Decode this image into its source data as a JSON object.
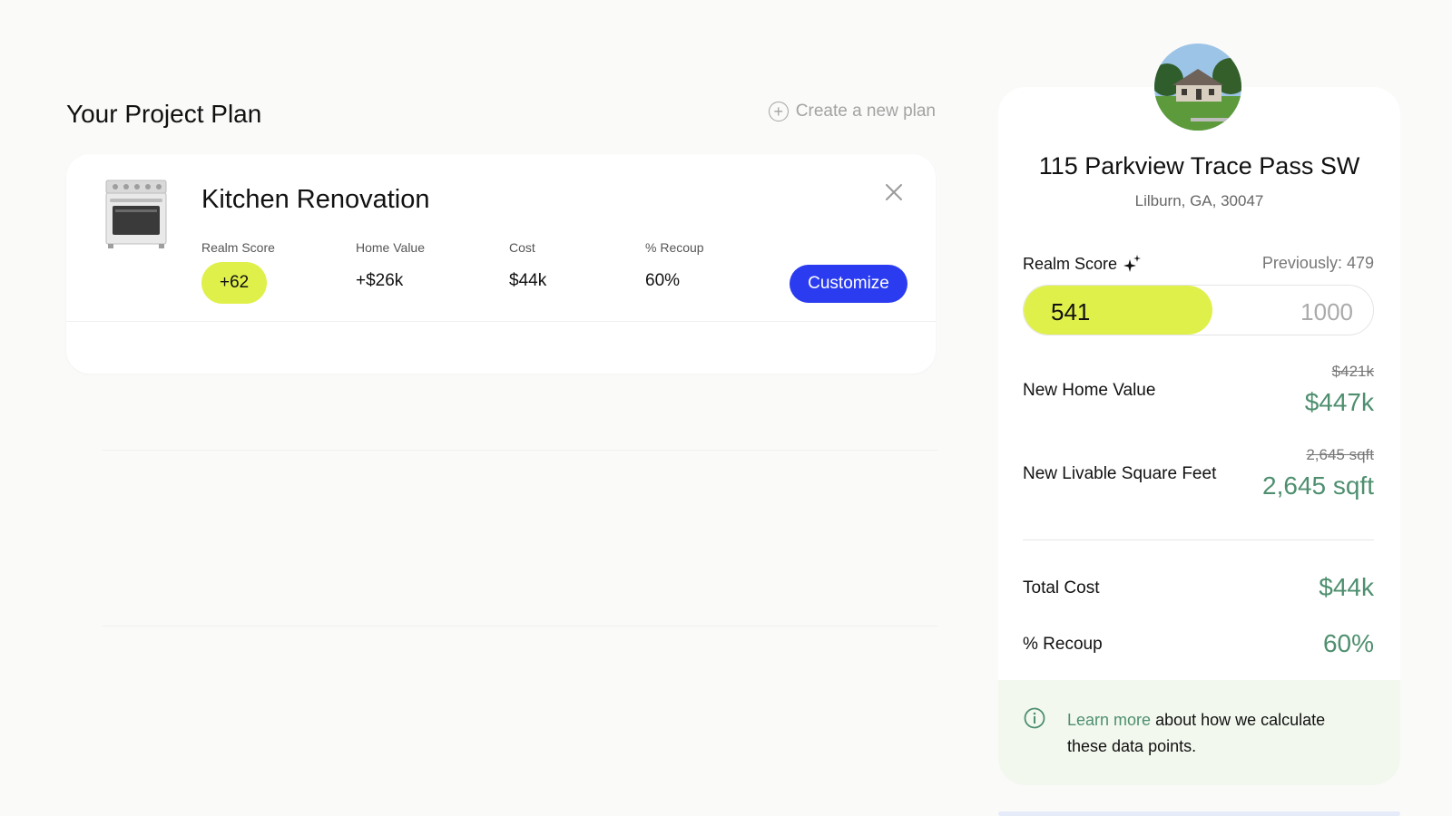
{
  "plan": {
    "title": "Your Project Plan",
    "new_plan_label": "Create a new plan"
  },
  "project": {
    "title": "Kitchen Renovation",
    "image_icon": "stove-icon",
    "metrics": {
      "realm_score_label": "Realm Score",
      "realm_score_value": "+62",
      "home_value_label": "Home Value",
      "home_value_value": "+$26k",
      "cost_label": "Cost",
      "cost_value": "$44k",
      "recoup_label": "% Recoup",
      "recoup_value": "60%"
    },
    "customize_label": "Customize",
    "close_icon": "close-icon"
  },
  "property": {
    "address": "115 Parkview Trace Pass SW",
    "city": "Lilburn, GA, 30047",
    "realm_score_label": "Realm Score",
    "previous_label": "Previously: 479",
    "score_value": "541",
    "score_max": "1000",
    "score_fraction": 0.541,
    "new_home_value_label": "New Home Value",
    "old_home_value": "$421k",
    "new_home_value": "$447k",
    "sqft_label": "New Livable Square Feet",
    "old_sqft": "2,645 sqft",
    "new_sqft": "2,645 sqft",
    "total_cost_label": "Total Cost",
    "total_cost": "$44k",
    "recoup_label": "% Recoup",
    "recoup": "60%",
    "info_link": "Learn more",
    "info_text": " about how we calculate these data points."
  },
  "colors": {
    "accent_lime": "#dff04a",
    "button_blue": "#2b3cf0",
    "value_green": "#4e8f6f",
    "info_bg": "#f2f8ee"
  }
}
